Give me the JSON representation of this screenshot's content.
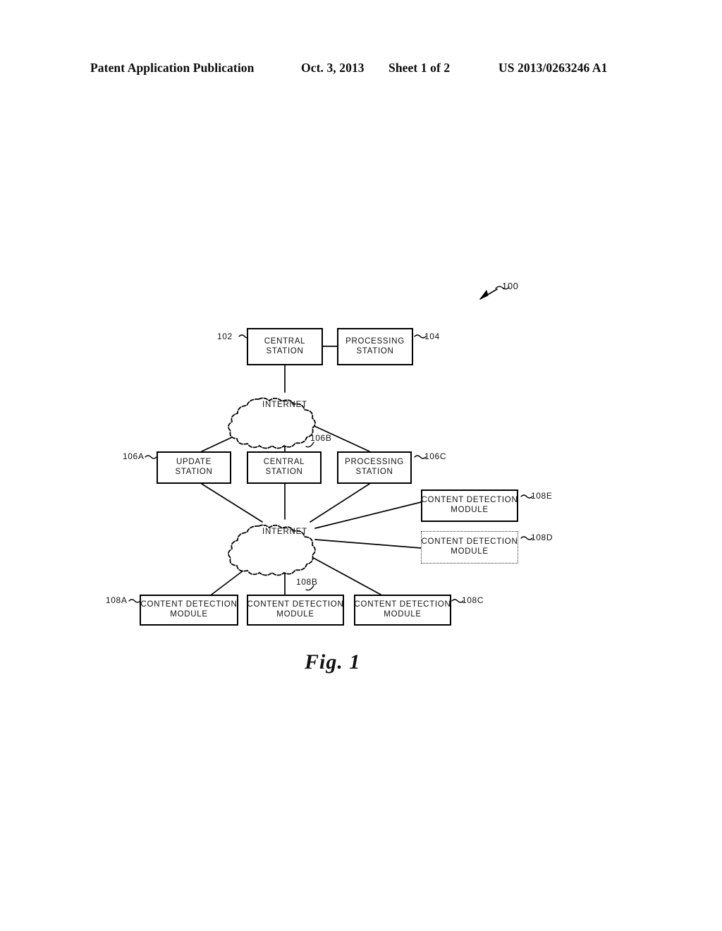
{
  "header": {
    "publication": "Patent Application Publication",
    "date": "Oct. 3, 2013",
    "sheet": "Sheet 1 of 2",
    "patent_number": "US 2013/0263246 A1"
  },
  "figure": {
    "caption": "Fig. 1",
    "system_ref": "100",
    "nodes": [
      {
        "id": "n102",
        "ref": "102",
        "line1": "CENTRAL",
        "line2": "STATION",
        "border": "solid"
      },
      {
        "id": "n104",
        "ref": "104",
        "line1": "PROCESSING",
        "line2": "STATION",
        "border": "solid"
      },
      {
        "id": "cloud1",
        "ref": "",
        "line1": "INTERNET",
        "line2": "",
        "border": "cloud"
      },
      {
        "id": "n106a",
        "ref": "106A",
        "line1": "UPDATE",
        "line2": "STATION",
        "border": "solid"
      },
      {
        "id": "n106b",
        "ref": "106B",
        "line1": "CENTRAL",
        "line2": "STATION",
        "border": "solid"
      },
      {
        "id": "n106c",
        "ref": "106C",
        "line1": "PROCESSING",
        "line2": "STATION",
        "border": "solid"
      },
      {
        "id": "cloud2",
        "ref": "",
        "line1": "INTERNET",
        "line2": "",
        "border": "cloud"
      },
      {
        "id": "n108e",
        "ref": "108E",
        "line1": "CONTENT  DETECTION",
        "line2": "MODULE",
        "border": "solid"
      },
      {
        "id": "n108d",
        "ref": "108D",
        "line1": "CONTENT  DETECTION",
        "line2": "MODULE",
        "border": "dotted"
      },
      {
        "id": "n108a",
        "ref": "108A",
        "line1": "CONTENT  DETECTION",
        "line2": "MODULE",
        "border": "solid"
      },
      {
        "id": "n108b",
        "ref": "108B",
        "line1": "CONTENT  DETECTION",
        "line2": "MODULE",
        "border": "solid"
      },
      {
        "id": "n108c",
        "ref": "108C",
        "line1": "CONTENT  DETECTION",
        "line2": "MODULE",
        "border": "solid"
      }
    ],
    "colors": {
      "ink": "#000000",
      "paper": "#ffffff"
    }
  }
}
